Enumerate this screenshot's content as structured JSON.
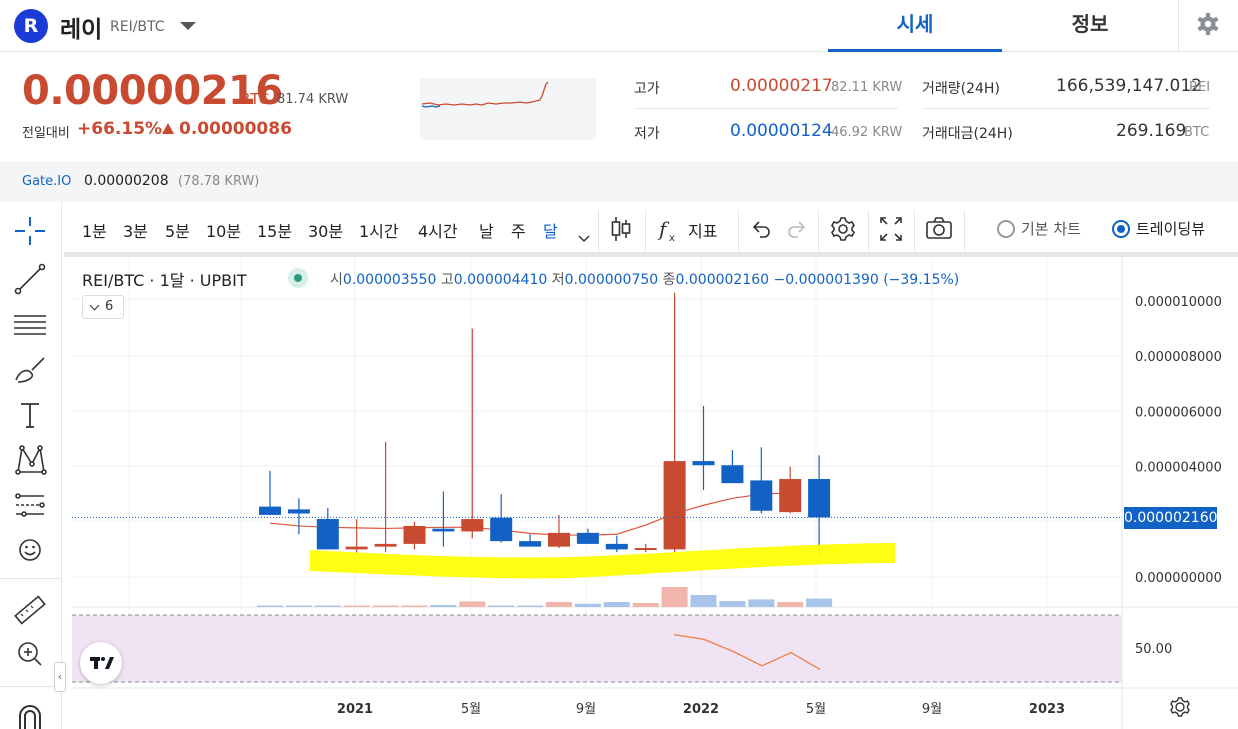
{
  "header": {
    "logo_letter": "R",
    "coin_name": "레이",
    "pair": "REI/BTC",
    "tabs": [
      {
        "label": "시세",
        "active": true
      },
      {
        "label": "정보",
        "active": false
      }
    ]
  },
  "price_panel": {
    "price": "0.00000216",
    "price_unit": "BTC",
    "price_krw": "81.74 KRW",
    "change_label": "전일대비",
    "change_pct": "+66.15%",
    "change_amount": "0.00000086",
    "high_label": "고가",
    "high_value": "0.00000217",
    "high_krw": "82.11 KRW",
    "low_label": "저가",
    "low_value": "0.00000124",
    "low_krw": "46.92 KRW",
    "volume_label": "거래량(24H)",
    "volume_value": "166,539,147.012",
    "volume_unit": "REI",
    "amount_label": "거래대금(24H)",
    "amount_value": "269.169",
    "amount_unit": "BTC"
  },
  "exchange_row": {
    "name": "Gate.IO",
    "price": "0.00000208",
    "krw": "(78.78 KRW)"
  },
  "chart_toolbar": {
    "intervals": [
      {
        "label": "1분"
      },
      {
        "label": "3분"
      },
      {
        "label": "5분"
      },
      {
        "label": "10분"
      },
      {
        "label": "15분"
      },
      {
        "label": "30분"
      },
      {
        "label": "1시간"
      },
      {
        "label": "4시간"
      },
      {
        "label": "날"
      },
      {
        "label": "주"
      },
      {
        "label": "달",
        "active": true
      }
    ],
    "indicator_label": "지표",
    "basic_chart_label": "기본 차트",
    "tradingview_label": "트레이딩뷰",
    "selected_view": "트레이딩뷰"
  },
  "chart_legend": {
    "symbol": "REI/BTC",
    "interval": "1달",
    "exchange": "UPBIT",
    "open_key": "시",
    "open": "0.000003550",
    "high_key": "고",
    "high": "0.000004410",
    "low_key": "저",
    "low": "0.000000750",
    "close_key": "종",
    "close": "0.000002160",
    "change": "−0.000001390 (−39.15%)",
    "collapsed_count": "6"
  },
  "chart_data": {
    "type": "candlestick",
    "y_unit": "BTC",
    "y_ticks": [
      "0.000010000",
      "0.000008000",
      "0.000006000",
      "0.000004000",
      "0.000000000"
    ],
    "y_range": [
      -1e-06,
      1.15e-05
    ],
    "last_price_tag": "0.000002160",
    "x_labels": [
      "2021",
      "5월",
      "9월",
      "2022",
      "5월",
      "9월",
      "2023"
    ],
    "candles": [
      {
        "o": 2.55,
        "h": 3.85,
        "l": 2.25,
        "c": 2.25
      },
      {
        "o": 2.45,
        "h": 2.85,
        "l": 1.55,
        "c": 2.3
      },
      {
        "o": 2.1,
        "h": 2.5,
        "l": 1.0,
        "c": 1.0
      },
      {
        "o": 1.0,
        "h": 2.1,
        "l": 0.85,
        "c": 1.1
      },
      {
        "o": 1.1,
        "h": 4.9,
        "l": 0.9,
        "c": 1.2
      },
      {
        "o": 1.2,
        "h": 2.0,
        "l": 1.0,
        "c": 1.85
      },
      {
        "o": 1.75,
        "h": 3.1,
        "l": 1.1,
        "c": 1.65
      },
      {
        "o": 1.65,
        "h": 9.0,
        "l": 1.4,
        "c": 2.1
      },
      {
        "o": 2.15,
        "h": 3.0,
        "l": 1.25,
        "c": 1.3
      },
      {
        "o": 1.3,
        "h": 1.55,
        "l": 1.15,
        "c": 1.1
      },
      {
        "o": 1.1,
        "h": 2.25,
        "l": 1.05,
        "c": 1.6
      },
      {
        "o": 1.6,
        "h": 1.75,
        "l": 1.2,
        "c": 1.2
      },
      {
        "o": 1.2,
        "h": 1.5,
        "l": 0.9,
        "c": 1.0
      },
      {
        "o": 1.05,
        "h": 1.2,
        "l": 0.9,
        "c": 1.05
      },
      {
        "o": 1.0,
        "h": 10.3,
        "l": 0.8,
        "c": 4.2
      },
      {
        "o": 4.2,
        "h": 6.2,
        "l": 3.15,
        "c": 4.05
      },
      {
        "o": 4.05,
        "h": 4.6,
        "l": 3.4,
        "c": 3.4
      },
      {
        "o": 3.5,
        "h": 4.7,
        "l": 2.3,
        "c": 2.4
      },
      {
        "o": 2.35,
        "h": 4.0,
        "l": 2.3,
        "c": 3.55
      },
      {
        "o": 3.55,
        "h": 4.41,
        "l": 0.75,
        "c": 2.16
      }
    ],
    "ma": [
      1.95,
      1.85,
      1.8,
      1.78,
      1.76,
      1.78,
      1.8,
      1.8,
      1.7,
      1.58,
      1.52,
      1.52,
      1.55,
      1.88,
      2.3,
      2.6,
      2.85,
      3.0,
      3.05
    ],
    "volumes": [
      0.06,
      0.05,
      0.05,
      0.05,
      0.06,
      0.07,
      0.1,
      0.28,
      0.07,
      0.07,
      0.25,
      0.16,
      0.25,
      0.2,
      1.0,
      0.6,
      0.3,
      0.38,
      0.25,
      0.42
    ],
    "indicator_tick": "50.00",
    "indicator_values": [
      62,
      58,
      48,
      36,
      47,
      33
    ],
    "highlight_color": "#ffff00",
    "up_color": "#c84a31",
    "down_color": "#1261c4"
  }
}
